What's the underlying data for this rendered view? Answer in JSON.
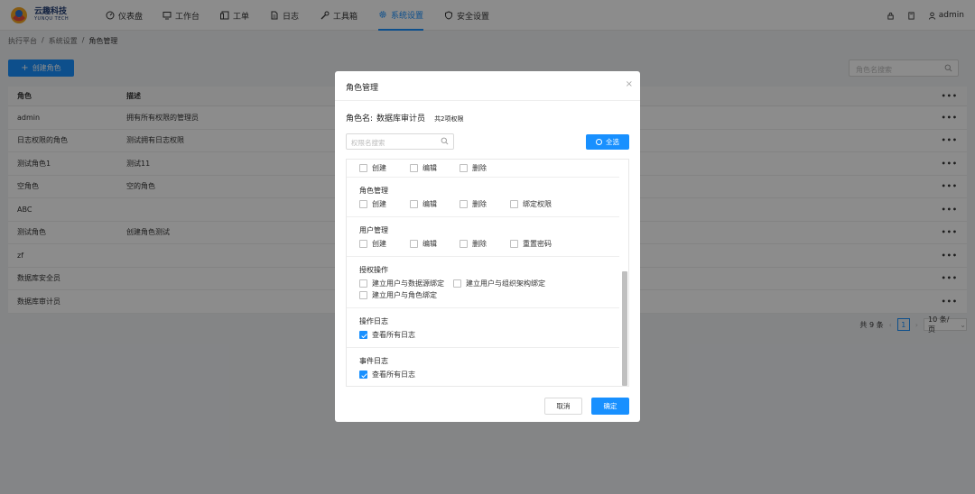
{
  "brand": {
    "name_cn": "云趣科技",
    "name_en": "YUNQU TECH"
  },
  "nav": [
    {
      "label": "仪表盘",
      "icon": "dashboard-icon"
    },
    {
      "label": "工作台",
      "icon": "monitor-icon"
    },
    {
      "label": "工单",
      "icon": "ticket-icon"
    },
    {
      "label": "日志",
      "icon": "file-icon"
    },
    {
      "label": "工具箱",
      "icon": "tool-icon"
    },
    {
      "label": "系统设置",
      "icon": "gear-icon",
      "active": true
    },
    {
      "label": "安全设置",
      "icon": "shield-icon"
    }
  ],
  "user": {
    "name": "admin"
  },
  "breadcrumb": [
    "执行平台",
    "系统设置",
    "角色管理"
  ],
  "create_button": "创建角色",
  "search_placeholder": "角色名搜索",
  "table": {
    "headers": [
      "角色",
      "描述",
      "•••"
    ],
    "rows": [
      [
        "admin",
        "拥有所有权限的管理员"
      ],
      [
        "日志权限的角色",
        "测试拥有日志权限"
      ],
      [
        "测试角色1",
        "测试11"
      ],
      [
        "空角色",
        "空的角色"
      ],
      [
        "ABC",
        ""
      ],
      [
        "测试角色",
        "创建角色测试"
      ],
      [
        "zf",
        ""
      ],
      [
        "数据库安全员",
        ""
      ],
      [
        "数据库审计员",
        ""
      ]
    ],
    "row_menu": "•••"
  },
  "pagination": {
    "total": "共 9 条",
    "current": "1",
    "page_size": "10 条/页"
  },
  "modal": {
    "title": "角色管理",
    "role_label": "角色名:",
    "role_name": "数据库审计员",
    "perm_count": "共2项权限",
    "search_placeholder": "权限名搜索",
    "select_all": "全选",
    "groups": [
      {
        "title": "",
        "items": [
          {
            "label": "创建",
            "checked": false
          },
          {
            "label": "编辑",
            "checked": false
          },
          {
            "label": "删除",
            "checked": false
          }
        ]
      },
      {
        "title": "角色管理",
        "items": [
          {
            "label": "创建",
            "checked": false
          },
          {
            "label": "编辑",
            "checked": false
          },
          {
            "label": "删除",
            "checked": false
          },
          {
            "label": "绑定权限",
            "checked": false
          }
        ]
      },
      {
        "title": "用户管理",
        "items": [
          {
            "label": "创建",
            "checked": false
          },
          {
            "label": "编辑",
            "checked": false
          },
          {
            "label": "删除",
            "checked": false
          },
          {
            "label": "重置密码",
            "checked": false
          }
        ]
      },
      {
        "title": "授权操作",
        "items": [
          {
            "label": "建立用户与数据源绑定",
            "checked": false
          },
          {
            "label": "建立用户与组织架构绑定",
            "checked": false
          },
          {
            "label": "建立用户与角色绑定",
            "checked": false
          }
        ]
      },
      {
        "title": "操作日志",
        "items": [
          {
            "label": "查看所有日志",
            "checked": true
          }
        ]
      },
      {
        "title": "事件日志",
        "items": [
          {
            "label": "查看所有日志",
            "checked": true
          }
        ]
      }
    ],
    "cancel": "取消",
    "ok": "确定"
  },
  "colors": {
    "primary": "#1890ff",
    "mask": "rgba(0,0,0,0.45)"
  }
}
